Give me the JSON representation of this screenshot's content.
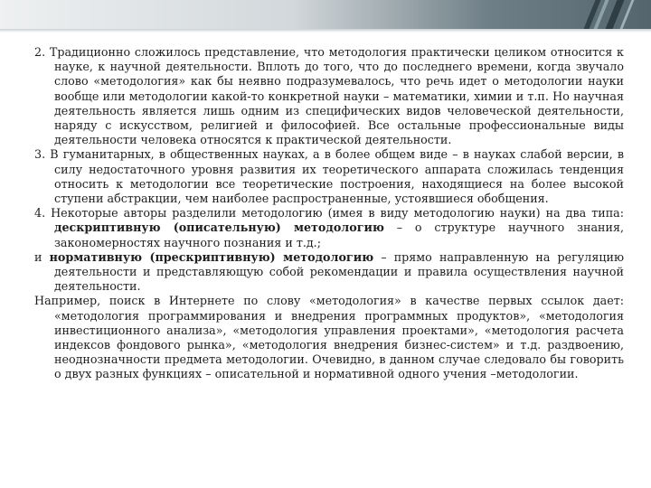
{
  "paragraphs": {
    "p2": "2. Традиционно сложилось представление, что методология практически целиком относится к науке, к научной деятельности. Вплоть до того, что до последнего времени, когда звучало слово «методология» как бы неявно подразумевалось, что речь идет о методологии науки вообще или методологии какой-то конкретной науки – математики, химии и т.п. Но научная деятельность является лишь одним из специфических видов человеческой деятельности, наряду с искусством, религией и философией. Все остальные профессиональные виды деятельности человека относятся к практической деятельности.",
    "p3": "3. В гуманитарных, в общественных науках, а в более общем виде – в науках слабой версии, в силу недостаточного уровня развития их теоретического аппарата сложилась тенденция относить к методологии все теоретические построения, находящиеся на более высокой ступени абстракции, чем наиболее распространенные, устоявшиеся обобщения.",
    "p4": {
      "prefix": "4. Некоторые авторы разделили методологию (имея в виду методологию науки) на два типа: ",
      "bold": "дескриптивную (описательную) методологию",
      "suffix": " – о структуре научного знания, закономерностях научного познания и т.д.;"
    },
    "p5": {
      "prefix": "и ",
      "bold": "нормативную (прескриптивную) методологию",
      "suffix": " – прямо направленную на регуляцию деятельности и представляющую собой рекомендации и правила осуществления научной деятельности."
    },
    "p6": "Например, поиск в Интернете по слову «методология» в качестве первых ссылок дает: «методология программирования и внедрения программных продуктов», «методология инвестиционного анализа», «методология управления проектами», «методология расчета индексов фондового рынка», «методология внедрения бизнес-систем» и т.д. раздвоению, неоднозначности предмета методологии. Очевидно, в данном случае следовало бы говорить о двух разных функциях – описательной и нормативной одного учения –методологии."
  },
  "colors": {
    "header_dark": "#2f3d44",
    "header_light": "#eef0f1",
    "text": "#1e1e1e"
  }
}
